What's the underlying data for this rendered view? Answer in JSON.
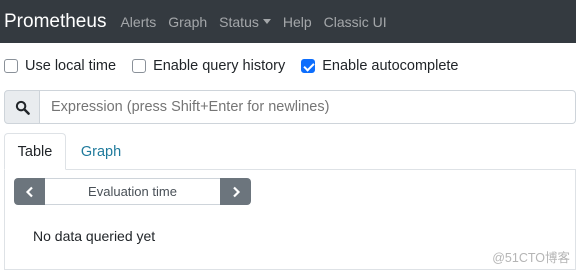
{
  "navbar": {
    "brand": "Prometheus",
    "links": [
      "Alerts",
      "Graph",
      "Status",
      "Help",
      "Classic UI"
    ],
    "bg_color": "#343a40"
  },
  "options": {
    "use_local_time": {
      "label": "Use local time",
      "checked": false
    },
    "enable_query_history": {
      "label": "Enable query history",
      "checked": false
    },
    "enable_autocomplete": {
      "label": "Enable autocomplete",
      "checked": true
    }
  },
  "search": {
    "icon": "search-icon",
    "placeholder": "Expression (press Shift+Enter for newlines)"
  },
  "tabs": [
    {
      "label": "Table",
      "active": true
    },
    {
      "label": "Graph",
      "active": false
    }
  ],
  "table": {
    "eval_time_placeholder": "Evaluation time",
    "prev_icon": "chevron-left-icon",
    "next_icon": "chevron-right-icon",
    "no_data": "No data queried yet"
  },
  "watermark": "@51CTO博客",
  "colors": {
    "accent": "#0d6efd",
    "link": "#1f7a9c",
    "button_gray": "#6c757d"
  }
}
